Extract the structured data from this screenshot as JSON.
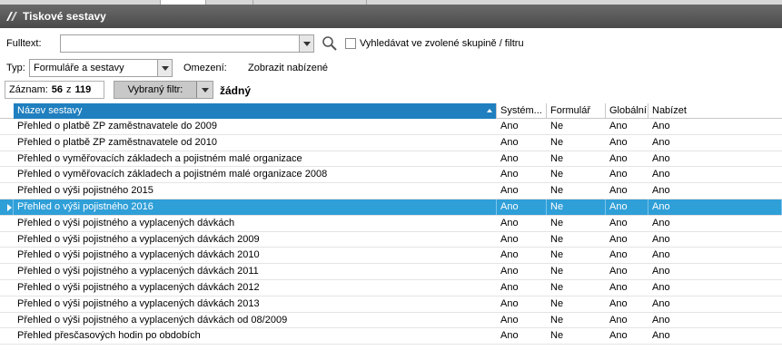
{
  "window": {
    "title": "Tiskové sestavy"
  },
  "filters": {
    "fulltext_label": "Fulltext:",
    "fulltext_value": "",
    "search_in_group_label": "Vyhledávat ve zvolené skupině / filtru",
    "type_label": "Typ:",
    "type_value": "Formuláře a sestavy",
    "limit_label": "Omezení:",
    "limit_value": "Zobrazit nabízené"
  },
  "counter": {
    "label": "Záznam:",
    "current": "56",
    "sep": "z",
    "total": "119"
  },
  "selected_filter": {
    "button_label": "Vybraný filtr:",
    "value": "žádný"
  },
  "grid": {
    "columns": [
      "Název sestavy",
      "Systém...",
      "Formulář",
      "Globální",
      "Nabízet"
    ],
    "rows": [
      [
        "Přehled o platbě ZP zaměstnavatele  do 2009",
        "Ano",
        "Ne",
        "Ano",
        "Ano"
      ],
      [
        "Přehled o platbě ZP zaměstnavatele od 2010",
        "Ano",
        "Ne",
        "Ano",
        "Ano"
      ],
      [
        "Přehled o vyměřovacích základech a pojistném malé organizace",
        "Ano",
        "Ne",
        "Ano",
        "Ano"
      ],
      [
        "Přehled o vyměřovacích základech a pojistném malé organizace 2008",
        "Ano",
        "Ne",
        "Ano",
        "Ano"
      ],
      [
        "Přehled o výši pojistného 2015",
        "Ano",
        "Ne",
        "Ano",
        "Ano"
      ],
      [
        "Přehled o výši pojistného 2016",
        "Ano",
        "Ne",
        "Ano",
        "Ano"
      ],
      [
        "Přehled o výši pojistného a vyplacených dávkách",
        "Ano",
        "Ne",
        "Ano",
        "Ano"
      ],
      [
        "Přehled o výši pojistného a vyplacených dávkách 2009",
        "Ano",
        "Ne",
        "Ano",
        "Ano"
      ],
      [
        "Přehled o výši pojistného a vyplacených dávkách 2010",
        "Ano",
        "Ne",
        "Ano",
        "Ano"
      ],
      [
        "Přehled o výši pojistného a vyplacených dávkách 2011",
        "Ano",
        "Ne",
        "Ano",
        "Ano"
      ],
      [
        "Přehled o výši pojistného a vyplacených dávkách 2012",
        "Ano",
        "Ne",
        "Ano",
        "Ano"
      ],
      [
        "Přehled o výši pojistného a vyplacených dávkách 2013",
        "Ano",
        "Ne",
        "Ano",
        "Ano"
      ],
      [
        "Přehled o výši pojistného a vyplacených dávkách od 08/2009",
        "Ano",
        "Ne",
        "Ano",
        "Ano"
      ],
      [
        "Přehled přesčasových hodin po obdobích",
        "Ano",
        "Ne",
        "Ano",
        "Ano"
      ]
    ],
    "selected_row_index": 5
  },
  "colors": {
    "selection": "#2f9fd8",
    "header_sorted": "#1f7fbf",
    "titlebar": "#555555"
  },
  "icons": {
    "app_logo": "app-logo-icon",
    "search": "search-icon",
    "dropdown": "chevron-down-icon"
  }
}
